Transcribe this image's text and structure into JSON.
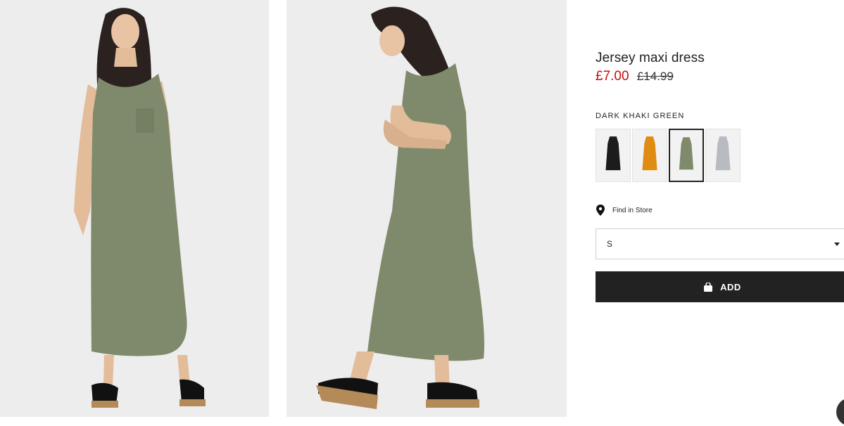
{
  "product": {
    "title": "Jersey maxi dress",
    "price_sale": "£7.00",
    "price_original": "£14.99"
  },
  "color": {
    "selected_label": "DARK KHAKI GREEN",
    "swatches": [
      {
        "name": "black",
        "hex": "#1c1c1c"
      },
      {
        "name": "mustard",
        "hex": "#e08c12"
      },
      {
        "name": "dark-khaki-green",
        "hex": "#7f8a6c",
        "selected": true
      },
      {
        "name": "grey-marl",
        "hex": "#b8bbbf"
      }
    ]
  },
  "store": {
    "find_label": "Find in Store",
    "icon": "location-pin-icon"
  },
  "size": {
    "selected": "S"
  },
  "cart": {
    "add_label": "ADD",
    "icon": "shopping-bag-icon"
  },
  "colors": {
    "sale": "#c90c0f",
    "button_bg": "#222222",
    "dress": "#7f8a6c",
    "photo_bg": "#ededed"
  }
}
